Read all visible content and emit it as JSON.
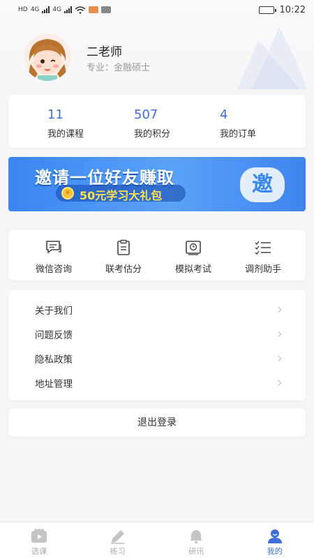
{
  "status_bar": {
    "network_left": "HD",
    "network_type": "4G",
    "time": "10:22",
    "battery_level": 0.85
  },
  "profile": {
    "name": "二老师",
    "major_label": "专业：",
    "major_value": "金融硕士"
  },
  "stats": [
    {
      "value": "11",
      "label": "我的课程"
    },
    {
      "value": "507",
      "label": "我的积分"
    },
    {
      "value": "4",
      "label": "我的订单"
    }
  ],
  "banner": {
    "title": "邀请一位好友赚取",
    "subtitle": "50元学习大礼包",
    "badge": "邀",
    "coin": "¥"
  },
  "quick_actions": [
    {
      "label": "微信咨询",
      "icon": "chat-icon"
    },
    {
      "label": "联考估分",
      "icon": "clipboard-icon"
    },
    {
      "label": "模拟考试",
      "icon": "exam-icon"
    },
    {
      "label": "调剂助手",
      "icon": "checklist-icon"
    }
  ],
  "menu": [
    {
      "label": "关于我们"
    },
    {
      "label": "问题反馈"
    },
    {
      "label": "隐私政策"
    },
    {
      "label": "地址管理"
    }
  ],
  "logout_label": "退出登录",
  "tabbar": [
    {
      "label": "选课",
      "icon": "play-icon",
      "active": false
    },
    {
      "label": "练习",
      "icon": "pencil-icon",
      "active": false
    },
    {
      "label": "研讯",
      "icon": "bell-icon",
      "active": false
    },
    {
      "label": "我的",
      "icon": "user-icon",
      "active": true
    }
  ],
  "colors": {
    "accent": "#3e6fd8",
    "banner_blue": "#3a86f2",
    "banner_yellow": "#ffe14a"
  }
}
